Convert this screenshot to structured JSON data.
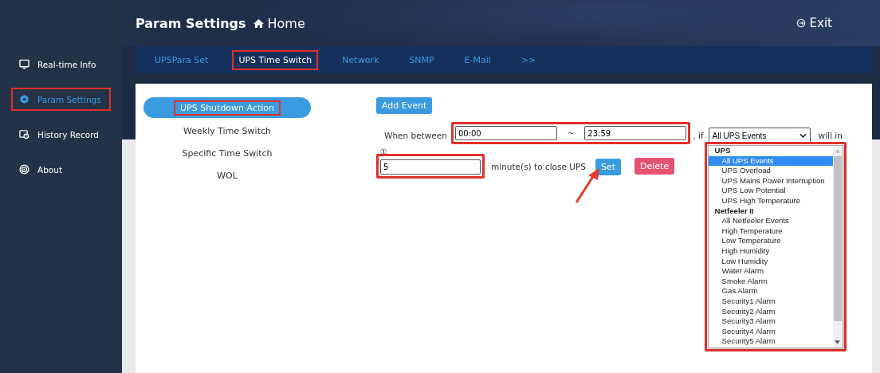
{
  "sidebar": {
    "items": [
      {
        "kind": "monitor",
        "label": "Real-time Info",
        "selected": false,
        "highlighted": false
      },
      {
        "kind": "gear",
        "label": "Param Settings",
        "selected": true,
        "highlighted": true
      },
      {
        "kind": "history",
        "label": "History Record",
        "selected": false,
        "highlighted": false
      },
      {
        "kind": "target",
        "label": "About",
        "selected": false,
        "highlighted": false
      }
    ]
  },
  "header": {
    "title": "Param Settings",
    "home": "Home",
    "exit": "Exit"
  },
  "tabs": [
    {
      "label": "UPSPara Set",
      "selected": false,
      "highlighted": false
    },
    {
      "label": "UPS Time Switch",
      "selected": true,
      "highlighted": true
    },
    {
      "label": "Network",
      "selected": false,
      "highlighted": false
    },
    {
      "label": "SNMP",
      "selected": false,
      "highlighted": false
    },
    {
      "label": "E-Mail",
      "selected": false,
      "highlighted": false
    },
    {
      "label": ">>",
      "selected": false,
      "highlighted": false
    }
  ],
  "submenu": [
    {
      "label": "UPS Shutdown Action",
      "selected": true,
      "highlighted": true
    },
    {
      "label": "Weekly Time Switch",
      "selected": false,
      "highlighted": false
    },
    {
      "label": "Specific Time Switch",
      "selected": false,
      "highlighted": false
    },
    {
      "label": "WOL",
      "selected": false,
      "highlighted": false
    }
  ],
  "form": {
    "add_button": "Add Event",
    "when_label": "When between",
    "start": "00:00",
    "tilde": "~",
    "end": "23:59",
    "if_label": ", if",
    "event_select": "All UPS Events",
    "will_label": "will in",
    "index": "①",
    "minutes": "5",
    "minutes_label": "minute(s) to close UPS",
    "set_button": "Set",
    "delete_button": "Delete",
    "time_highlighted": true,
    "minutes_highlighted": true,
    "list_highlighted": true,
    "arrow_to_set": true
  },
  "event_list": [
    {
      "kind": "group",
      "label": "UPS"
    },
    {
      "kind": "option",
      "label": "All UPS Events",
      "selected": true
    },
    {
      "kind": "option",
      "label": "UPS Overload",
      "selected": false
    },
    {
      "kind": "option",
      "label": "UPS Mains Power Interruption",
      "selected": false
    },
    {
      "kind": "option",
      "label": "UPS Low Potential",
      "selected": false
    },
    {
      "kind": "option",
      "label": "UPS High Temperature",
      "selected": false
    },
    {
      "kind": "group",
      "label": "Netfeeler II"
    },
    {
      "kind": "option",
      "label": "All Netfeeler Events",
      "selected": false
    },
    {
      "kind": "option",
      "label": "High Temperature",
      "selected": false
    },
    {
      "kind": "option",
      "label": "Low Temperature",
      "selected": false
    },
    {
      "kind": "option",
      "label": "High Humidity",
      "selected": false
    },
    {
      "kind": "option",
      "label": "Low Humidity",
      "selected": false
    },
    {
      "kind": "option",
      "label": "Water Alarm",
      "selected": false
    },
    {
      "kind": "option",
      "label": "Smoke Alarm",
      "selected": false
    },
    {
      "kind": "option",
      "label": "Gas Alarm",
      "selected": false
    },
    {
      "kind": "option",
      "label": "Security1 Alarm",
      "selected": false
    },
    {
      "kind": "option",
      "label": "Security2 Alarm",
      "selected": false
    },
    {
      "kind": "option",
      "label": "Security3 Alarm",
      "selected": false
    },
    {
      "kind": "option",
      "label": "Security4 Alarm",
      "selected": false
    },
    {
      "kind": "option",
      "label": "Security5 Alarm",
      "selected": false
    }
  ]
}
